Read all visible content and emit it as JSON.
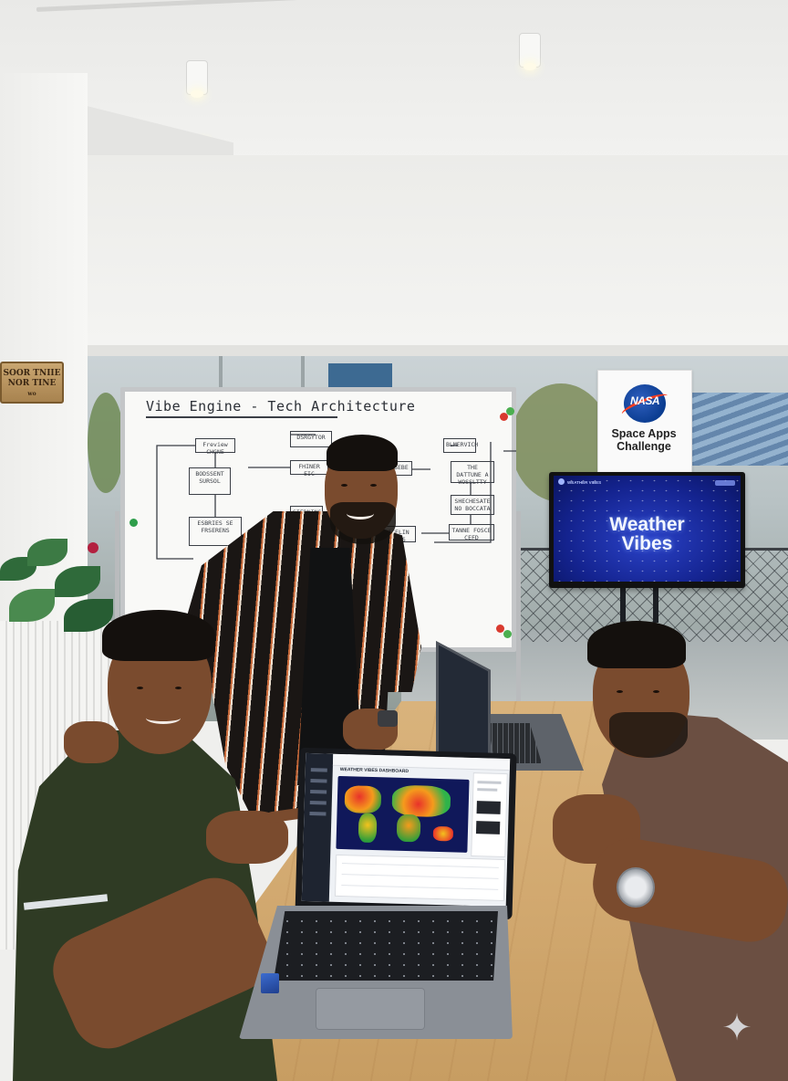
{
  "wood_sign": {
    "line1": "SOOR TNIIE",
    "line2": "NOR TINE",
    "line3": "wo"
  },
  "whiteboard": {
    "title": "Vibe Engine - Tech Architecture",
    "boxes": [
      "Freview CHGNE",
      "BODSSENT SURSOL",
      "ESBRIES SE FRSERENS",
      "DSRGYTOR",
      "FHINER EIC",
      "SIEDNINS",
      "WASEBE",
      "BLMERVICH",
      "THE DATTUNE A WOSSLTTY",
      "SHECHESATE NO BOCCATA",
      "TANNE FOSCE CEFD",
      "EICELIN WORKS"
    ]
  },
  "banner": {
    "logo_text": "NASA",
    "line1": "Space Apps",
    "line2": "Challenge"
  },
  "tv": {
    "header_left": "WEATHER VIBES",
    "line1": "Weather",
    "line2": "Vibes"
  },
  "laptop_app": {
    "header": "WEATHER VIBES DASHBOARD"
  },
  "colors": {
    "tv_blue": "#14238f",
    "nasa_blue": "#0b3d91",
    "nasa_red": "#fc3d21",
    "table_wood": "#d2a970"
  },
  "icons": {
    "sparkle": "sparkle-icon"
  }
}
